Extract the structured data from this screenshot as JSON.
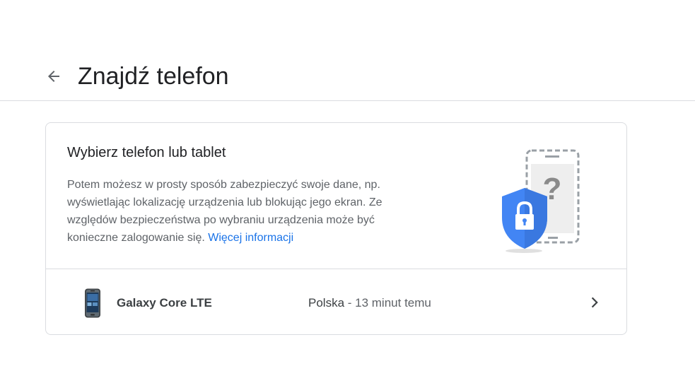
{
  "header": {
    "title": "Znajdź telefon",
    "back_icon": "arrow-back-icon"
  },
  "card": {
    "heading": "Wybierz telefon lub tablet",
    "description": "Potem możesz w prosty sposób zabezpieczyć swoje dane, np. wyświetlając lokalizację urządzenia lub blokując jego ekran. Ze względów bezpieczeństwa po wybraniu urządzenia może być konieczne zalogowanie się.",
    "more_link": "Więcej informacji",
    "illustration_icon": "phone-shield-lock-icon"
  },
  "devices": [
    {
      "name": "Galaxy Core LTE",
      "location": "Polska",
      "separator": " - ",
      "last_seen": "13 minut temu",
      "icon": "smartphone-icon"
    }
  ],
  "colors": {
    "link": "#1a73e8",
    "shield": "#4285f4",
    "divider": "#dadce0"
  }
}
